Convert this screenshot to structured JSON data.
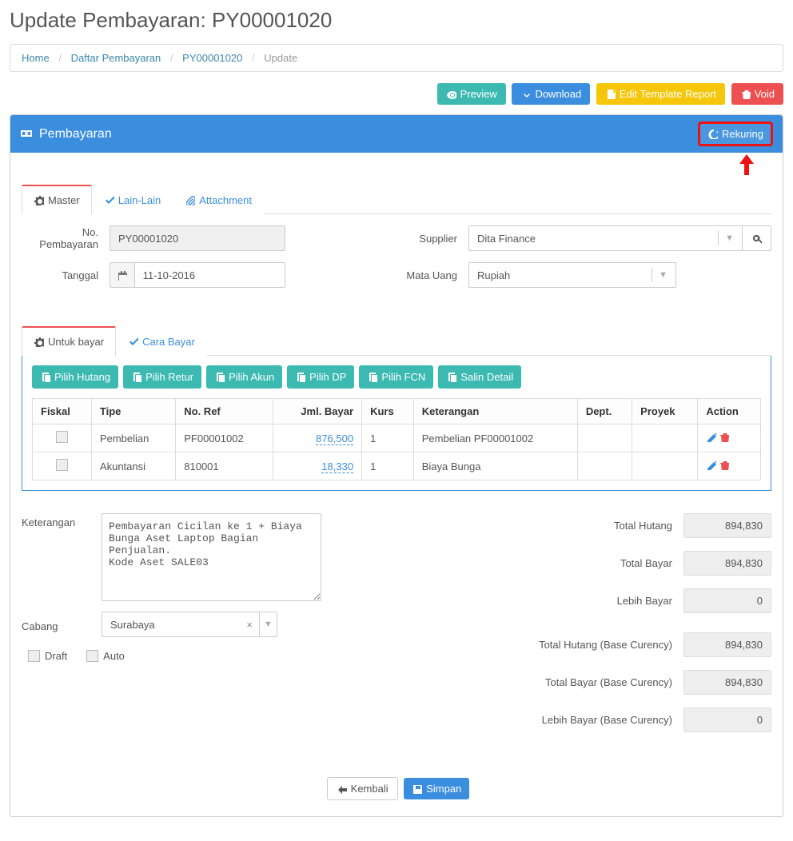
{
  "page_title_prefix": "Update Pembayaran: ",
  "page_id": "PY00001020",
  "breadcrumb": {
    "home": "Home",
    "list": "Daftar Pembayaran",
    "id": "PY00001020",
    "current": "Update"
  },
  "toolbar": {
    "preview": "Preview",
    "download": "Download",
    "edit_template": "Edit Template Report",
    "void": "Void"
  },
  "panel": {
    "title": "Pembayaran",
    "rekuring": "Rekuring"
  },
  "tabs": {
    "master": "Master",
    "lain": "Lain-Lain",
    "attachment": "Attachment"
  },
  "form": {
    "no_label": "No. Pembayaran",
    "no_value": "PY00001020",
    "tanggal_label": "Tanggal",
    "tanggal_value": "11-10-2016",
    "supplier_label": "Supplier",
    "supplier_value": "Dita Finance",
    "mata_uang_label": "Mata Uang",
    "mata_uang_value": "Rupiah"
  },
  "subtabs": {
    "untuk_bayar": "Untuk bayar",
    "cara_bayar": "Cara Bayar"
  },
  "actions": {
    "pilih_hutang": "Pilih Hutang",
    "pilih_retur": "Pilih Retur",
    "pilih_akun": "Pilih Akun",
    "pilih_dp": "Pilih DP",
    "pilih_fcn": "Pilih FCN",
    "salin_detail": "Salin Detail"
  },
  "grid": {
    "headers": {
      "fiskal": "Fiskal",
      "tipe": "Tipe",
      "noref": "No. Ref",
      "jml": "Jml. Bayar",
      "kurs": "Kurs",
      "ket": "Keterangan",
      "dept": "Dept.",
      "proyek": "Proyek",
      "action": "Action"
    },
    "rows": [
      {
        "tipe": "Pembelian",
        "noref": "PF00001002",
        "jml": "876,500",
        "kurs": "1",
        "ket": "Pembelian PF00001002",
        "dept": "",
        "proyek": ""
      },
      {
        "tipe": "Akuntansi",
        "noref": "810001",
        "jml": "18,330",
        "kurs": "1",
        "ket": "Biaya Bunga",
        "dept": "",
        "proyek": ""
      }
    ]
  },
  "summary": {
    "keterangan_label": "Keterangan",
    "keterangan_value": "Pembayaran Cicilan ke 1 + Biaya Bunga Aset Laptop Bagian Penjualan.\nKode Aset SALE03",
    "cabang_label": "Cabang",
    "cabang_value": "Surabaya",
    "draft": "Draft",
    "auto": "Auto"
  },
  "totals": {
    "total_hutang_label": "Total Hutang",
    "total_hutang": "894,830",
    "total_bayar_label": "Total Bayar",
    "total_bayar": "894,830",
    "lebih_bayar_label": "Lebih Bayar",
    "lebih_bayar": "0",
    "total_hutang_base_label": "Total Hutang (Base Curency)",
    "total_hutang_base": "894,830",
    "total_bayar_base_label": "Total Bayar (Base Curency)",
    "total_bayar_base": "894,830",
    "lebih_bayar_base_label": "Lebih Bayar (Base Curency)",
    "lebih_bayar_base": "0"
  },
  "footer": {
    "kembali": "Kembali",
    "simpan": "Simpan"
  }
}
